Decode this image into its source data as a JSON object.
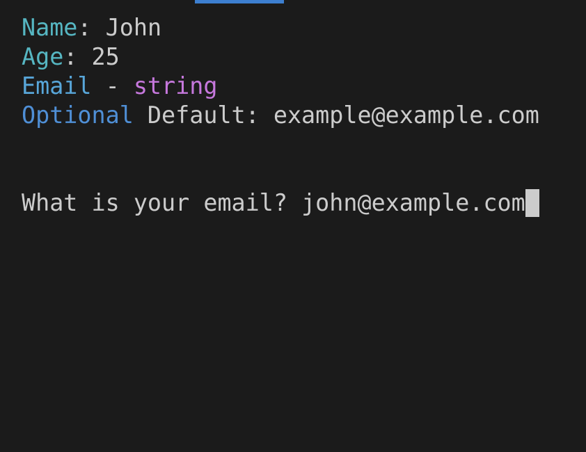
{
  "lines": {
    "name": {
      "label": "Name",
      "sep": ": ",
      "value": "John"
    },
    "age": {
      "label": "Age",
      "sep": ": ",
      "value": "25"
    },
    "email": {
      "label": "Email",
      "sep": " - ",
      "type": "string"
    },
    "optional": {
      "label": "Optional",
      "text": " Default: example@example.com"
    }
  },
  "prompt": {
    "question": "What is your email? ",
    "input": "john@example.com"
  },
  "colors": {
    "background": "#1b1b1b",
    "foreground": "#cccccc",
    "field_key": "#56b6c2",
    "optional": "#4f8fd6",
    "type": "#c678dd",
    "tab_indicator": "#3d7fd0"
  }
}
